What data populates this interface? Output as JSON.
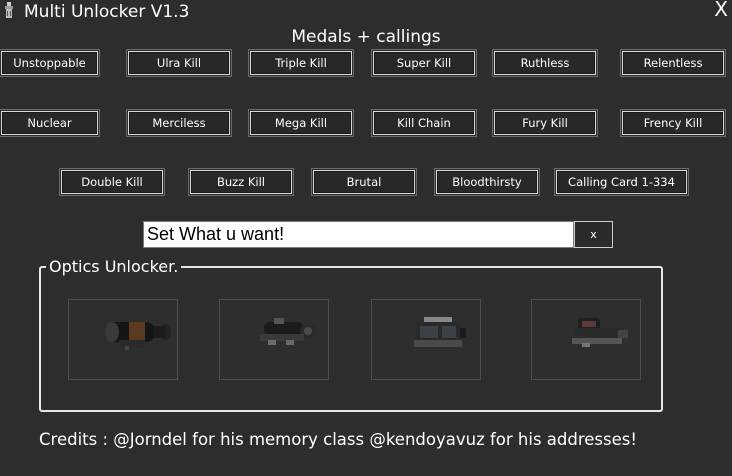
{
  "window": {
    "title": "Multi Unlocker V1.3",
    "close_label": "X"
  },
  "medals": {
    "title": "Medals + callings",
    "row1": [
      "Unstoppable",
      "Ulra Kill",
      "Triple Kill",
      "Super Kill",
      "Ruthless",
      "Relentless"
    ],
    "row2": [
      "Nuclear",
      "Merciless",
      "Mega Kill",
      "Kill Chain",
      "Fury Kill",
      "Frency Kill"
    ],
    "row3": [
      "Double Kill",
      "Buzz Kill",
      "Brutal",
      "Bloodthirsty",
      "Calling Card 1-334"
    ]
  },
  "input": {
    "value": "Set What u want!",
    "clear_label": "x"
  },
  "optics": {
    "label": "Optics Unlocker.",
    "items": [
      "scope-optic-icon",
      "rifle-scope-optic-icon",
      "thermal-optic-icon",
      "red-dot-optic-icon"
    ]
  },
  "credits": "Credits : @Jorndel for his memory class @kendoyavuz for his addresses!"
}
